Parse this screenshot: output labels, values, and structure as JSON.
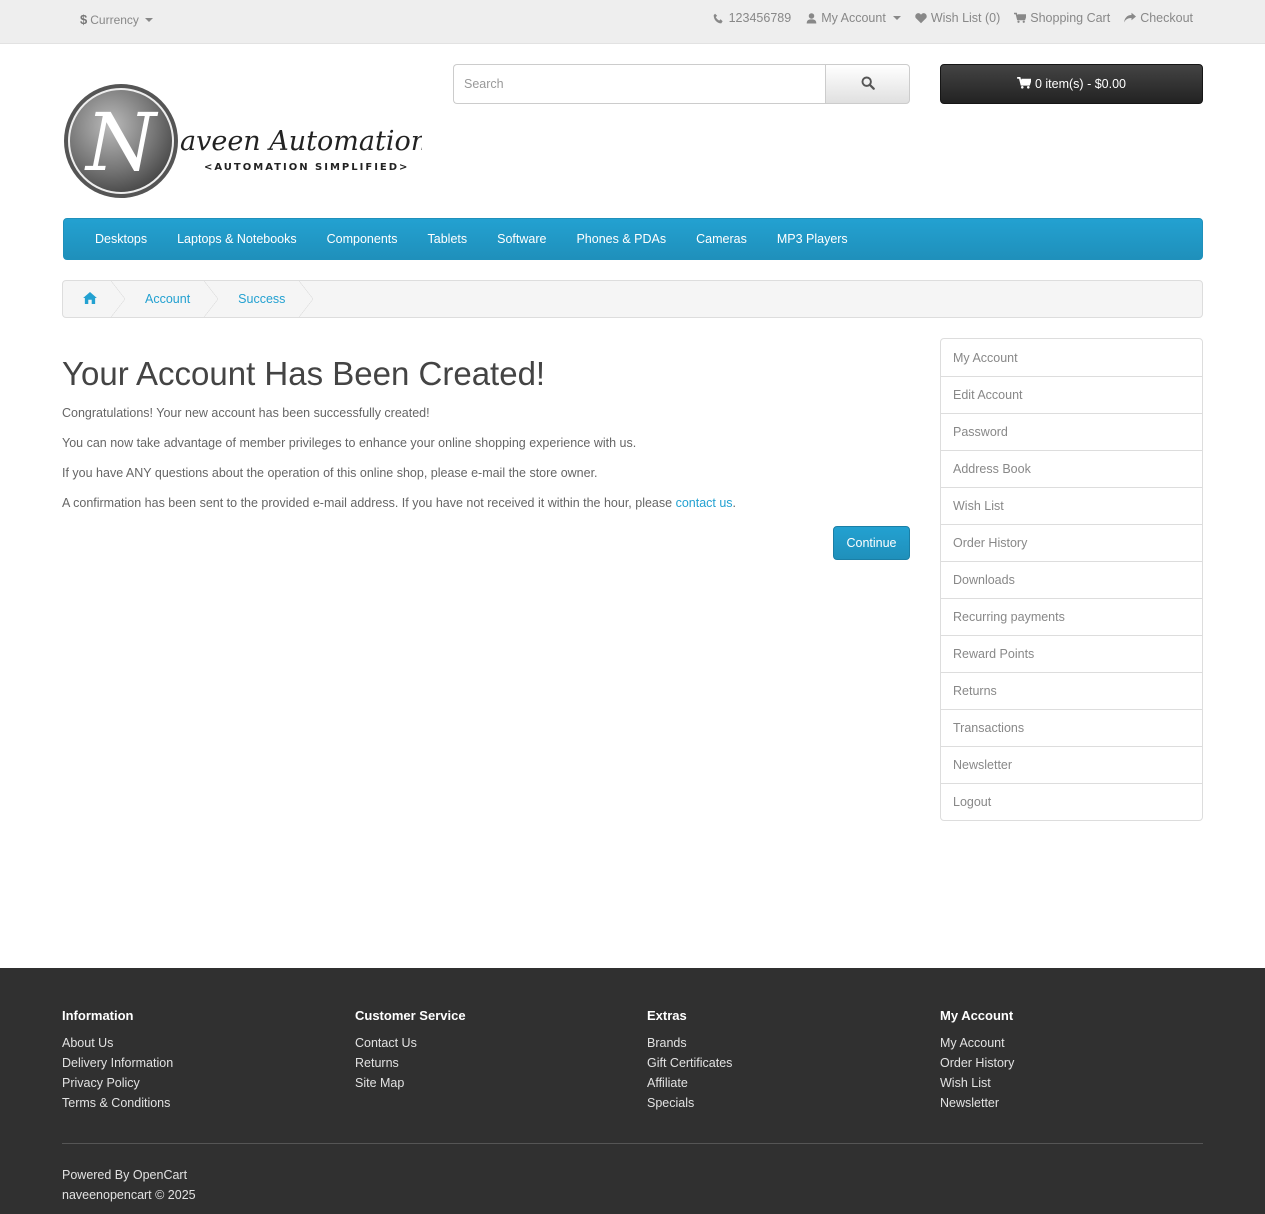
{
  "top": {
    "currency_symbol": "$",
    "currency_label": "Currency",
    "phone": "123456789",
    "my_account": "My Account",
    "wish_list": "Wish List (0)",
    "shopping_cart": "Shopping Cart",
    "checkout": "Checkout"
  },
  "header": {
    "logo_text": "aveen Automation Labs",
    "logo_letter": "N",
    "logo_tagline": "<AUTOMATION SIMPLIFIED>",
    "search_placeholder": "Search",
    "cart_label": "0 item(s) - $0.00"
  },
  "menu": [
    "Desktops",
    "Laptops & Notebooks",
    "Components",
    "Tablets",
    "Software",
    "Phones & PDAs",
    "Cameras",
    "MP3 Players"
  ],
  "breadcrumb": {
    "account": "Account",
    "success": "Success"
  },
  "main": {
    "title": "Your Account Has Been Created!",
    "p1": "Congratulations! Your new account has been successfully created!",
    "p2": "You can now take advantage of member privileges to enhance your online shopping experience with us.",
    "p3": "If you have ANY questions about the operation of this online shop, please e-mail the store owner.",
    "p4_before": "A confirmation has been sent to the provided e-mail address. If you have not received it within the hour, please ",
    "p4_link": "contact us",
    "p4_after": ".",
    "continue": "Continue"
  },
  "sidebar": [
    "My Account",
    "Edit Account",
    "Password",
    "Address Book",
    "Wish List",
    "Order History",
    "Downloads",
    "Recurring payments",
    "Reward Points",
    "Returns",
    "Transactions",
    "Newsletter",
    "Logout"
  ],
  "footer": {
    "information": {
      "title": "Information",
      "links": [
        "About Us",
        "Delivery Information",
        "Privacy Policy",
        "Terms & Conditions"
      ]
    },
    "customer_service": {
      "title": "Customer Service",
      "links": [
        "Contact Us",
        "Returns",
        "Site Map"
      ]
    },
    "extras": {
      "title": "Extras",
      "links": [
        "Brands",
        "Gift Certificates",
        "Affiliate",
        "Specials"
      ]
    },
    "my_account": {
      "title": "My Account",
      "links": [
        "My Account",
        "Order History",
        "Wish List",
        "Newsletter"
      ]
    },
    "powered_prefix": "Powered By ",
    "powered_link": "OpenCart",
    "copyright": "naveenopencart © 2025"
  }
}
